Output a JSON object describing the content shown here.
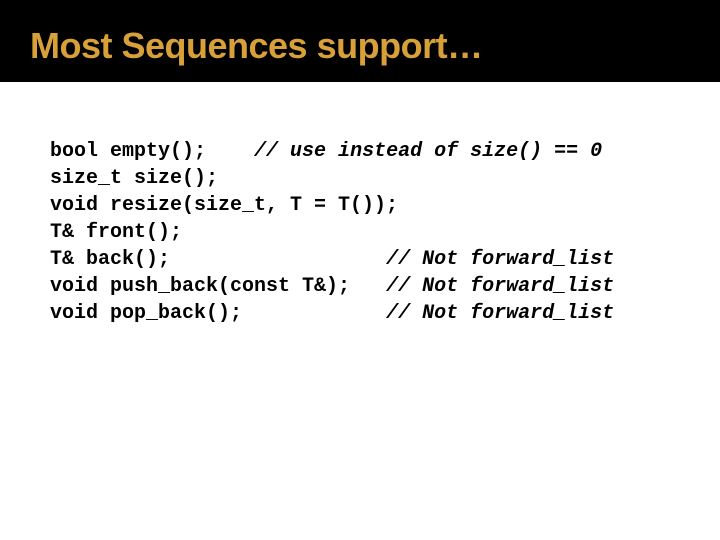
{
  "title": "Most Sequences support…",
  "code": {
    "lines": [
      {
        "text": "bool empty();    ",
        "comment": "// use instead of size() == 0"
      },
      {
        "text": "size_t size();",
        "comment": ""
      },
      {
        "text": "void resize(size_t, T = T());",
        "comment": ""
      },
      {
        "text": "T& front();",
        "comment": ""
      },
      {
        "text": "T& back();                  ",
        "comment": "// Not forward_list"
      },
      {
        "text": "void push_back(const T&);   ",
        "comment": "// Not forward_list"
      },
      {
        "text": "void pop_back();            ",
        "comment": "// Not forward_list"
      }
    ]
  }
}
